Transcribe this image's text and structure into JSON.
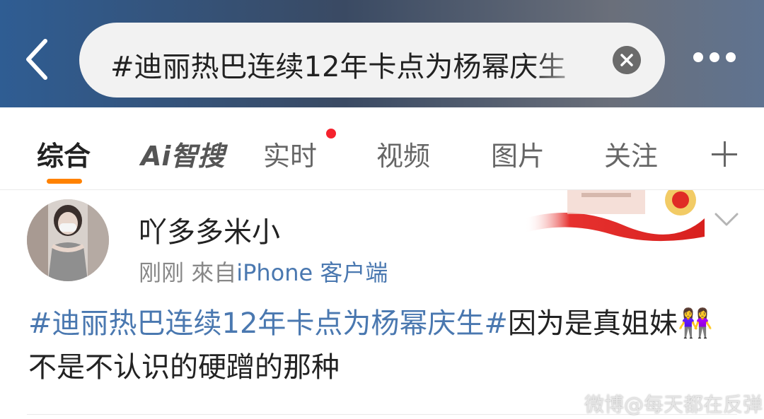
{
  "header": {
    "back_icon": "back-chevron-icon",
    "search_query": "#迪丽热巴连续12年卡点为杨幂庆生",
    "clear_icon": "clear-x-icon",
    "more_icon": "more-dots-icon"
  },
  "tabs": [
    {
      "label": "综合",
      "active": true
    },
    {
      "label": "Ai智搜",
      "active": false
    },
    {
      "label": "实时",
      "active": false,
      "has_dot": true
    },
    {
      "label": "视频",
      "active": false
    },
    {
      "label": "图片",
      "active": false
    },
    {
      "label": "关注",
      "active": false
    }
  ],
  "tabs_add_icon": "plus-icon",
  "post": {
    "username": "吖多多米小",
    "time": "刚刚",
    "from_prefix": "來自",
    "source": "iPhone 客户端",
    "hashtag": "#迪丽热巴连续12年卡点为杨幂庆生#",
    "text_part1": "因为是真姐妹",
    "emoji": "👭",
    "text_part2": "不是不认识的硬蹭的那种",
    "menu_icon": "chevron-down-icon"
  },
  "watermark": "微博@每天都在反弹",
  "colors": {
    "accent": "#ff8200",
    "link": "#4a78b0",
    "dot": "#f5222d"
  }
}
